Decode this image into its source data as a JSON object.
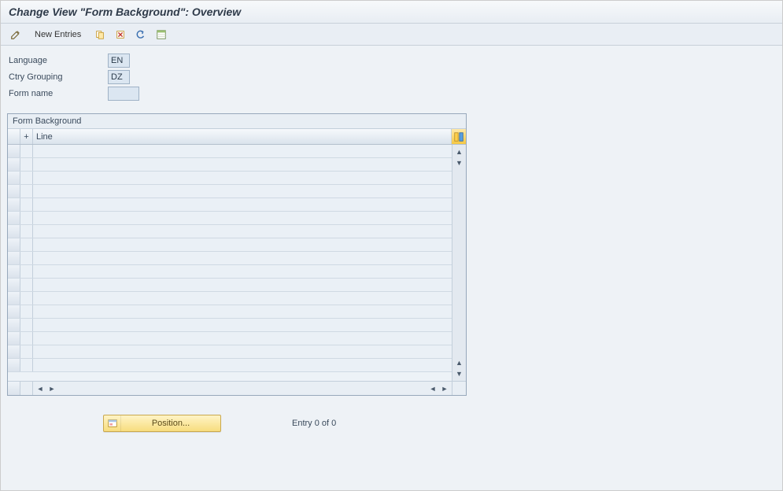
{
  "title": "Change View \"Form Background\": Overview",
  "toolbar": {
    "new_entries_label": "New Entries"
  },
  "fields": {
    "language_label": "Language",
    "language_value": "EN",
    "ctry_grouping_label": "Ctry Grouping",
    "ctry_grouping_value": "DZ",
    "form_name_label": "Form name",
    "form_name_value": ""
  },
  "table": {
    "title": "Form Background",
    "columns": {
      "plus": "+",
      "line": "Line"
    },
    "rows": [
      "",
      "",
      "",
      "",
      "",
      "",
      "",
      "",
      "",
      "",
      "",
      "",
      "",
      "",
      "",
      "",
      ""
    ]
  },
  "footer": {
    "position_label": "Position...",
    "entry_text": "Entry 0 of 0"
  }
}
